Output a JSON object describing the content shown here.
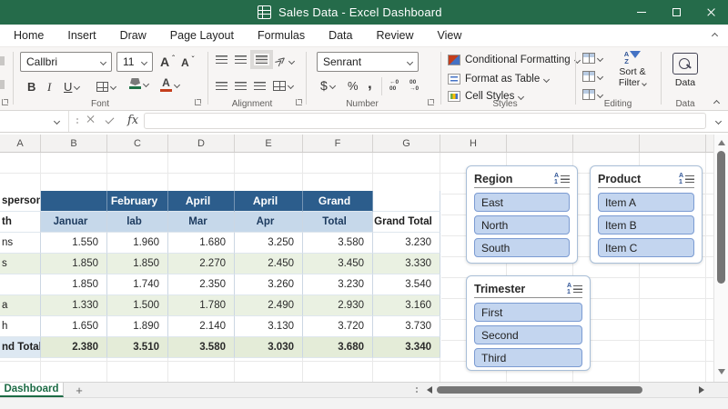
{
  "colors": {
    "titlebar_green": "#256b4a",
    "header_dark_blue": "#2c5d8c",
    "header_light_blue": "#c6d8ea",
    "band_green": "#eaf1e2",
    "slicer_fill": "#c3d5ef",
    "slicer_border": "#7b9bd2",
    "active_tab_green": "#1c6b45"
  },
  "titlebar": {
    "title": "Sales Data - Excel Dashboard"
  },
  "menu": {
    "tabs": [
      "Home",
      "Insert",
      "Draw",
      "Page Layout",
      "Formulas",
      "Data",
      "Review",
      "View"
    ]
  },
  "ribbon": {
    "font": {
      "name": "Callbri",
      "size": "11",
      "grow": "A",
      "shrink": "A",
      "bold": "B",
      "italic": "I",
      "underline": "U",
      "font_color_letter": "A",
      "label": "Font"
    },
    "alignment": {
      "label": "Alignment"
    },
    "number": {
      "format": "Senrant",
      "dollar": "$",
      "percent": "%",
      "comma": ",",
      "inc_dec": "←0",
      "inc_dec2": "00",
      "dec_dec": "00",
      "dec_dec2": "→0",
      "label": "Number"
    },
    "styles": {
      "conditional": "Conditional Formatting",
      "format_table": "Format as Table",
      "cell_styles": "Cell Styles",
      "label": "Styles"
    },
    "editing": {
      "sort_icon_top": "A",
      "sort_icon_bottom": "Z",
      "sort_line1": "Sort &",
      "sort_line2": "Filter",
      "label": "Editing"
    },
    "data_group": {
      "button": "Data",
      "label": "Data"
    }
  },
  "formula_bar": {
    "fx": "fx",
    "value": ""
  },
  "grid": {
    "columns": [
      "A",
      "B",
      "C",
      "D",
      "E",
      "F",
      "G",
      "H"
    ]
  },
  "table": {
    "h1": [
      "sperson",
      "",
      "February",
      "April",
      "April",
      "Grand",
      ""
    ],
    "h2": [
      "th",
      "Januar",
      "lab",
      "Mar",
      "Apr",
      "Total",
      "Grand Total"
    ],
    "rows": [
      [
        "ns",
        "1.550",
        "1.960",
        "1.680",
        "3.250",
        "3.580",
        "3.230"
      ],
      [
        "s",
        "1.850",
        "1.850",
        "2.270",
        "2.450",
        "3.450",
        "3.330"
      ],
      [
        "",
        "1.850",
        "1.740",
        "2.350",
        "3.260",
        "3.230",
        "3.540"
      ],
      [
        "a",
        "1.330",
        "1.500",
        "1.780",
        "2.490",
        "2.930",
        "3.160"
      ],
      [
        "h",
        "1.650",
        "1.890",
        "2.140",
        "3.130",
        "3.720",
        "3.730"
      ]
    ],
    "total": [
      "nd Total",
      "2.380",
      "3.510",
      "3.580",
      "3.030",
      "3.680",
      "3.340"
    ]
  },
  "slicers": [
    {
      "title": "Region",
      "items": [
        "East",
        "North",
        "South"
      ]
    },
    {
      "title": "Product",
      "items": [
        "Item A",
        "Item B",
        "Item C"
      ]
    },
    {
      "title": "Trimester",
      "items": [
        "First",
        "Second",
        "Third"
      ]
    }
  ],
  "sheetbar": {
    "active_tab": "Dashboard",
    "add": "+"
  }
}
